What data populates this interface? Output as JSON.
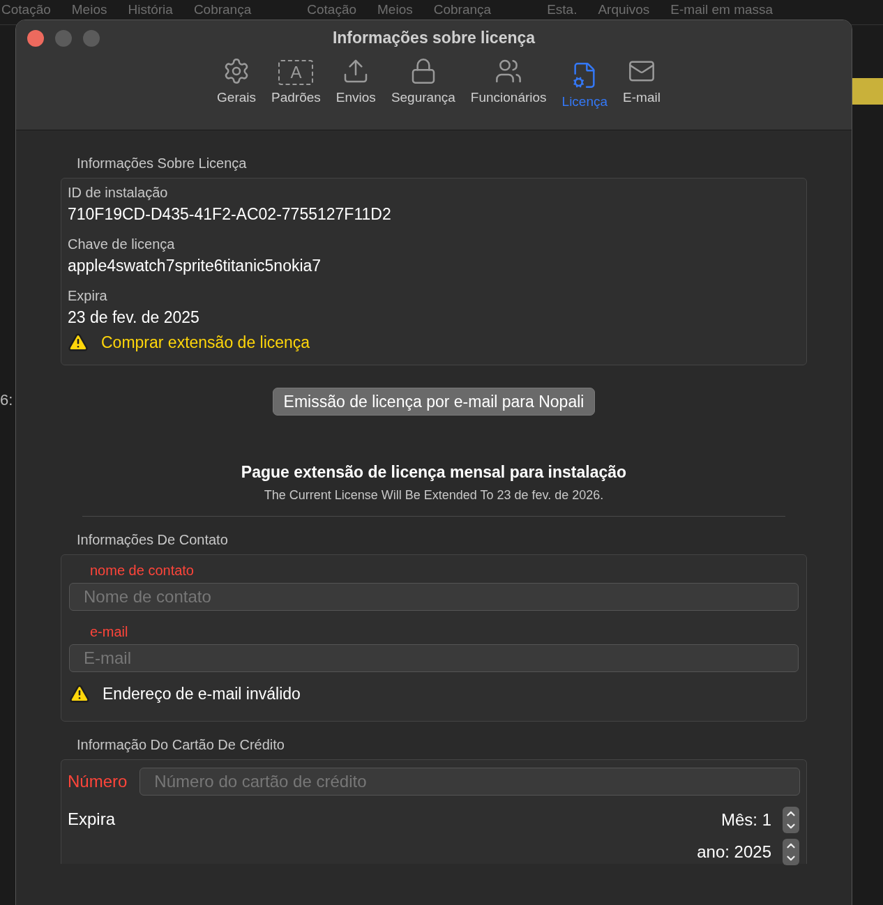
{
  "background_app": {
    "tabs": [
      "Cotação",
      "Meios",
      "História",
      "Cobrança",
      "Cotação",
      "Meios",
      "Cobrança",
      "Esta.",
      "Arquivos",
      "E-mail em massa"
    ],
    "side_text": "6:"
  },
  "window": {
    "title": "Informações sobre licença"
  },
  "toolbar": [
    {
      "kind": "gear",
      "label": "Gerais",
      "selected": false
    },
    {
      "kind": "letter",
      "icon_text": "A",
      "label": "Padrões",
      "selected": false
    },
    {
      "kind": "upload",
      "label": "Envios",
      "selected": false
    },
    {
      "kind": "lock",
      "label": "Segurança",
      "selected": false
    },
    {
      "kind": "people",
      "label": "Funcionários",
      "selected": false
    },
    {
      "kind": "license",
      "label": "Licença",
      "selected": true
    },
    {
      "kind": "mail",
      "label": "E-mail",
      "selected": false
    }
  ],
  "license_section": {
    "heading": "Informações Sobre Licença",
    "fields": [
      {
        "label": "ID de instalação",
        "value": "710F19CD-D435-41F2-AC02-7755127F11D2"
      },
      {
        "label": "Chave de licença",
        "value": "apple4swatch7sprite6titanic5nokia7"
      },
      {
        "label": "Expira",
        "value": "23 de fev. de 2025"
      }
    ],
    "warning_link": "Comprar extensão de licença"
  },
  "email_button": "Emissão de licença por e-mail para Nopali",
  "payment": {
    "title": "Pague extensão de licença mensal para instalação",
    "subtitle": "The Current License Will Be Extended To 23 de fev. de 2026."
  },
  "contact_section": {
    "heading": "Informações De Contato",
    "fields": [
      {
        "label": "nome de contato",
        "placeholder": "Nome de contato"
      },
      {
        "label": "e-mail",
        "placeholder": "E-mail"
      }
    ],
    "warning": "Endereço de e-mail inválido"
  },
  "card_section": {
    "heading": "Informação Do Cartão De Crédito",
    "number_label": "Número",
    "number_placeholder": "Número do cartão de crédito",
    "expiry_label": "Expira",
    "month": "Mês: 1",
    "year": "ano: 2025"
  }
}
